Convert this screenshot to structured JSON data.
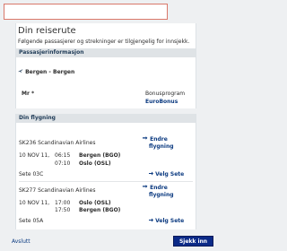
{
  "topbox": {
    "value": ""
  },
  "itinerary": {
    "title": "Din reiserute",
    "subtitle": "Følgende passasjerer og strekninger er tilgjengelig for innsjekk.",
    "section_label": "Passasjerinformasjon",
    "route": "Bergen - Bergen",
    "passenger_label": "Mr *",
    "bonus_label": "Bonusprogram",
    "bonus_value": "EuroBonus"
  },
  "flights": {
    "section_label": "Din flygning",
    "items": [
      {
        "flight": "SK236 Scandinavian Airlines",
        "change_label_1": "Endre",
        "change_label_2": "flygning",
        "date": "10 NOV 11,",
        "dep_time": "06:15",
        "dep_airport": "Bergen (BGO)",
        "arr_time": "07:10",
        "arr_airport": "Oslo (OSL)",
        "seat": "Sete 03C",
        "seat_action": "Velg Sete"
      },
      {
        "flight": "SK277 Scandinavian Airlines",
        "change_label_1": "Endre",
        "change_label_2": "flygning",
        "date": "10 NOV 11,",
        "dep_time": "17:00",
        "dep_airport": "Oslo (OSL)",
        "arr_time": "17:50",
        "arr_airport": "Bergen (BGO)",
        "seat": "Sete 05A",
        "seat_action": "Velg Sete"
      }
    ]
  },
  "footer": {
    "cancel_label": "Avslutt",
    "checkin_label": "Sjekk inn"
  },
  "colors": {
    "primary_button": "#0b2a88",
    "link": "#0b3a80",
    "topbox_border": "#d9786a"
  },
  "icons": {
    "route": "plane-icon",
    "change_flight": "arrows-icon",
    "seat": "seat-arrow-icon"
  }
}
